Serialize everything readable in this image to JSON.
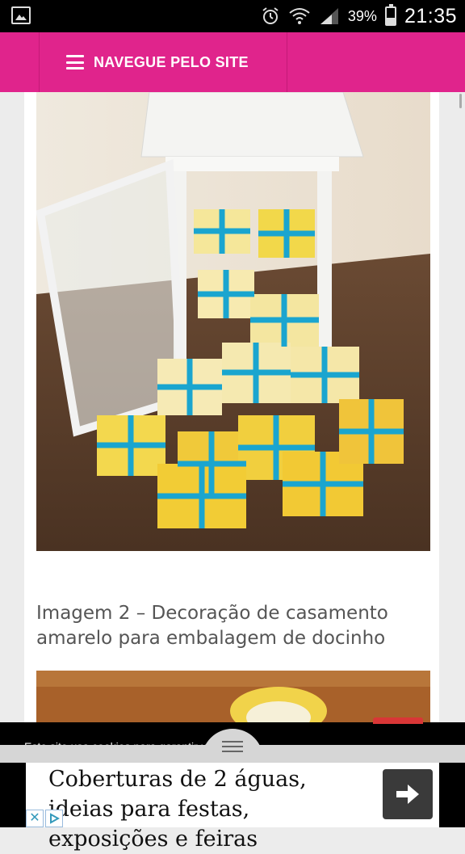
{
  "status_bar": {
    "battery_percent": "39%",
    "time": "21:35",
    "icons": [
      "image-icon",
      "alarm-icon",
      "wifi-icon",
      "signal-icon",
      "battery-icon"
    ]
  },
  "header": {
    "menu_label": "NAVEGUE PELO SITE",
    "background_color": "#e0248c",
    "menu_icon": "hamburger-icon"
  },
  "content": {
    "image1_alt": "",
    "caption": "Imagem 2 – Decoração de casamento amarelo para embalagem de docinho",
    "image2_alt": ""
  },
  "cookie_notice": {
    "text": "Este site usa cookies para garantir uma"
  },
  "ad": {
    "text": "Coberturas de 2 águas, ideias para festas, exposições e feiras",
    "arrow_icon": "arrow-right-icon",
    "choices_icons": [
      "close-icon",
      "adchoices-icon"
    ]
  }
}
